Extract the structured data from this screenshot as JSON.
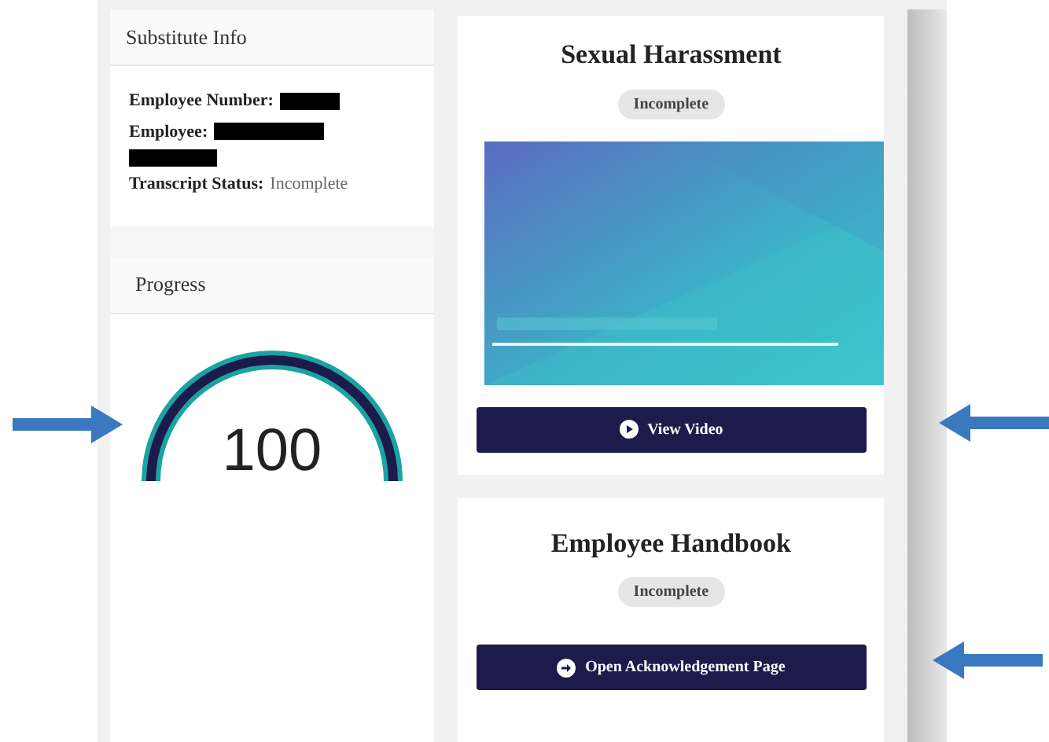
{
  "substitute_info": {
    "title": "Substitute Info",
    "fields": [
      {
        "kind": "redacted",
        "label": "Employee Number:"
      },
      {
        "kind": "redacted_long",
        "label": "Employee:"
      },
      {
        "kind": "text",
        "label": "Transcript Status:",
        "value": "Incomplete"
      }
    ]
  },
  "progress": {
    "title": "Progress",
    "reading": "100"
  },
  "courses": [
    {
      "kind": "video",
      "title": "Sexual Harassment",
      "status": "Incomplete",
      "button": "View Video"
    },
    {
      "kind": "document",
      "title": "Employee Handbook",
      "status": "Incomplete",
      "button": "Open Acknowledgement Page"
    }
  ]
}
